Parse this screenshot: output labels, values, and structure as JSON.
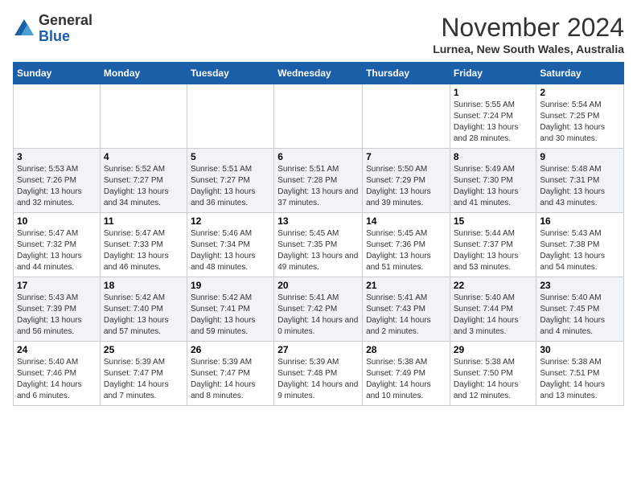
{
  "logo": {
    "general": "General",
    "blue": "Blue"
  },
  "header": {
    "month": "November 2024",
    "location": "Lurnea, New South Wales, Australia"
  },
  "weekdays": [
    "Sunday",
    "Monday",
    "Tuesday",
    "Wednesday",
    "Thursday",
    "Friday",
    "Saturday"
  ],
  "weeks": [
    [
      {
        "day": "",
        "info": ""
      },
      {
        "day": "",
        "info": ""
      },
      {
        "day": "",
        "info": ""
      },
      {
        "day": "",
        "info": ""
      },
      {
        "day": "",
        "info": ""
      },
      {
        "day": "1",
        "info": "Sunrise: 5:55 AM\nSunset: 7:24 PM\nDaylight: 13 hours and 28 minutes."
      },
      {
        "day": "2",
        "info": "Sunrise: 5:54 AM\nSunset: 7:25 PM\nDaylight: 13 hours and 30 minutes."
      }
    ],
    [
      {
        "day": "3",
        "info": "Sunrise: 5:53 AM\nSunset: 7:26 PM\nDaylight: 13 hours and 32 minutes."
      },
      {
        "day": "4",
        "info": "Sunrise: 5:52 AM\nSunset: 7:27 PM\nDaylight: 13 hours and 34 minutes."
      },
      {
        "day": "5",
        "info": "Sunrise: 5:51 AM\nSunset: 7:27 PM\nDaylight: 13 hours and 36 minutes."
      },
      {
        "day": "6",
        "info": "Sunrise: 5:51 AM\nSunset: 7:28 PM\nDaylight: 13 hours and 37 minutes."
      },
      {
        "day": "7",
        "info": "Sunrise: 5:50 AM\nSunset: 7:29 PM\nDaylight: 13 hours and 39 minutes."
      },
      {
        "day": "8",
        "info": "Sunrise: 5:49 AM\nSunset: 7:30 PM\nDaylight: 13 hours and 41 minutes."
      },
      {
        "day": "9",
        "info": "Sunrise: 5:48 AM\nSunset: 7:31 PM\nDaylight: 13 hours and 43 minutes."
      }
    ],
    [
      {
        "day": "10",
        "info": "Sunrise: 5:47 AM\nSunset: 7:32 PM\nDaylight: 13 hours and 44 minutes."
      },
      {
        "day": "11",
        "info": "Sunrise: 5:47 AM\nSunset: 7:33 PM\nDaylight: 13 hours and 46 minutes."
      },
      {
        "day": "12",
        "info": "Sunrise: 5:46 AM\nSunset: 7:34 PM\nDaylight: 13 hours and 48 minutes."
      },
      {
        "day": "13",
        "info": "Sunrise: 5:45 AM\nSunset: 7:35 PM\nDaylight: 13 hours and 49 minutes."
      },
      {
        "day": "14",
        "info": "Sunrise: 5:45 AM\nSunset: 7:36 PM\nDaylight: 13 hours and 51 minutes."
      },
      {
        "day": "15",
        "info": "Sunrise: 5:44 AM\nSunset: 7:37 PM\nDaylight: 13 hours and 53 minutes."
      },
      {
        "day": "16",
        "info": "Sunrise: 5:43 AM\nSunset: 7:38 PM\nDaylight: 13 hours and 54 minutes."
      }
    ],
    [
      {
        "day": "17",
        "info": "Sunrise: 5:43 AM\nSunset: 7:39 PM\nDaylight: 13 hours and 56 minutes."
      },
      {
        "day": "18",
        "info": "Sunrise: 5:42 AM\nSunset: 7:40 PM\nDaylight: 13 hours and 57 minutes."
      },
      {
        "day": "19",
        "info": "Sunrise: 5:42 AM\nSunset: 7:41 PM\nDaylight: 13 hours and 59 minutes."
      },
      {
        "day": "20",
        "info": "Sunrise: 5:41 AM\nSunset: 7:42 PM\nDaylight: 14 hours and 0 minutes."
      },
      {
        "day": "21",
        "info": "Sunrise: 5:41 AM\nSunset: 7:43 PM\nDaylight: 14 hours and 2 minutes."
      },
      {
        "day": "22",
        "info": "Sunrise: 5:40 AM\nSunset: 7:44 PM\nDaylight: 14 hours and 3 minutes."
      },
      {
        "day": "23",
        "info": "Sunrise: 5:40 AM\nSunset: 7:45 PM\nDaylight: 14 hours and 4 minutes."
      }
    ],
    [
      {
        "day": "24",
        "info": "Sunrise: 5:40 AM\nSunset: 7:46 PM\nDaylight: 14 hours and 6 minutes."
      },
      {
        "day": "25",
        "info": "Sunrise: 5:39 AM\nSunset: 7:47 PM\nDaylight: 14 hours and 7 minutes."
      },
      {
        "day": "26",
        "info": "Sunrise: 5:39 AM\nSunset: 7:47 PM\nDaylight: 14 hours and 8 minutes."
      },
      {
        "day": "27",
        "info": "Sunrise: 5:39 AM\nSunset: 7:48 PM\nDaylight: 14 hours and 9 minutes."
      },
      {
        "day": "28",
        "info": "Sunrise: 5:38 AM\nSunset: 7:49 PM\nDaylight: 14 hours and 10 minutes."
      },
      {
        "day": "29",
        "info": "Sunrise: 5:38 AM\nSunset: 7:50 PM\nDaylight: 14 hours and 12 minutes."
      },
      {
        "day": "30",
        "info": "Sunrise: 5:38 AM\nSunset: 7:51 PM\nDaylight: 14 hours and 13 minutes."
      }
    ]
  ]
}
